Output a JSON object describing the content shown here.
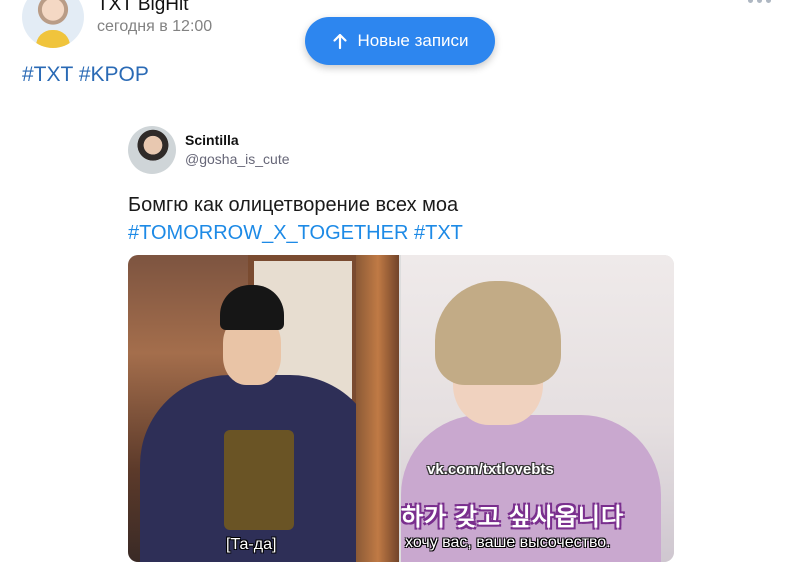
{
  "post": {
    "author": "TXT BigHit",
    "time": "сегодня в 12:00",
    "tags": [
      "#TXT",
      "#KPOP"
    ]
  },
  "new_posts_button": {
    "label": "Новые записи",
    "icon": "arrow-up-icon"
  },
  "more_icon": "more-dots-icon",
  "tweet": {
    "display_name": "Scintilla",
    "handle": "@gosha_is_cute",
    "text": "Бомгю как олицетворение всех моа",
    "tags": [
      "#TOMORROW_X_TOGETHER",
      "#TXT"
    ]
  },
  "media": {
    "left_caption": "[Та-да]",
    "watermark": "vk.com/txtlovebts",
    "korean_subtitle": "하가 갖고 싶사옵니다",
    "right_caption": "хочу вас, ваше высочество."
  },
  "colors": {
    "accent": "#2d86ef",
    "hashtag": "#2a6ab5",
    "tweet_hashtag": "#1d8ae6"
  }
}
